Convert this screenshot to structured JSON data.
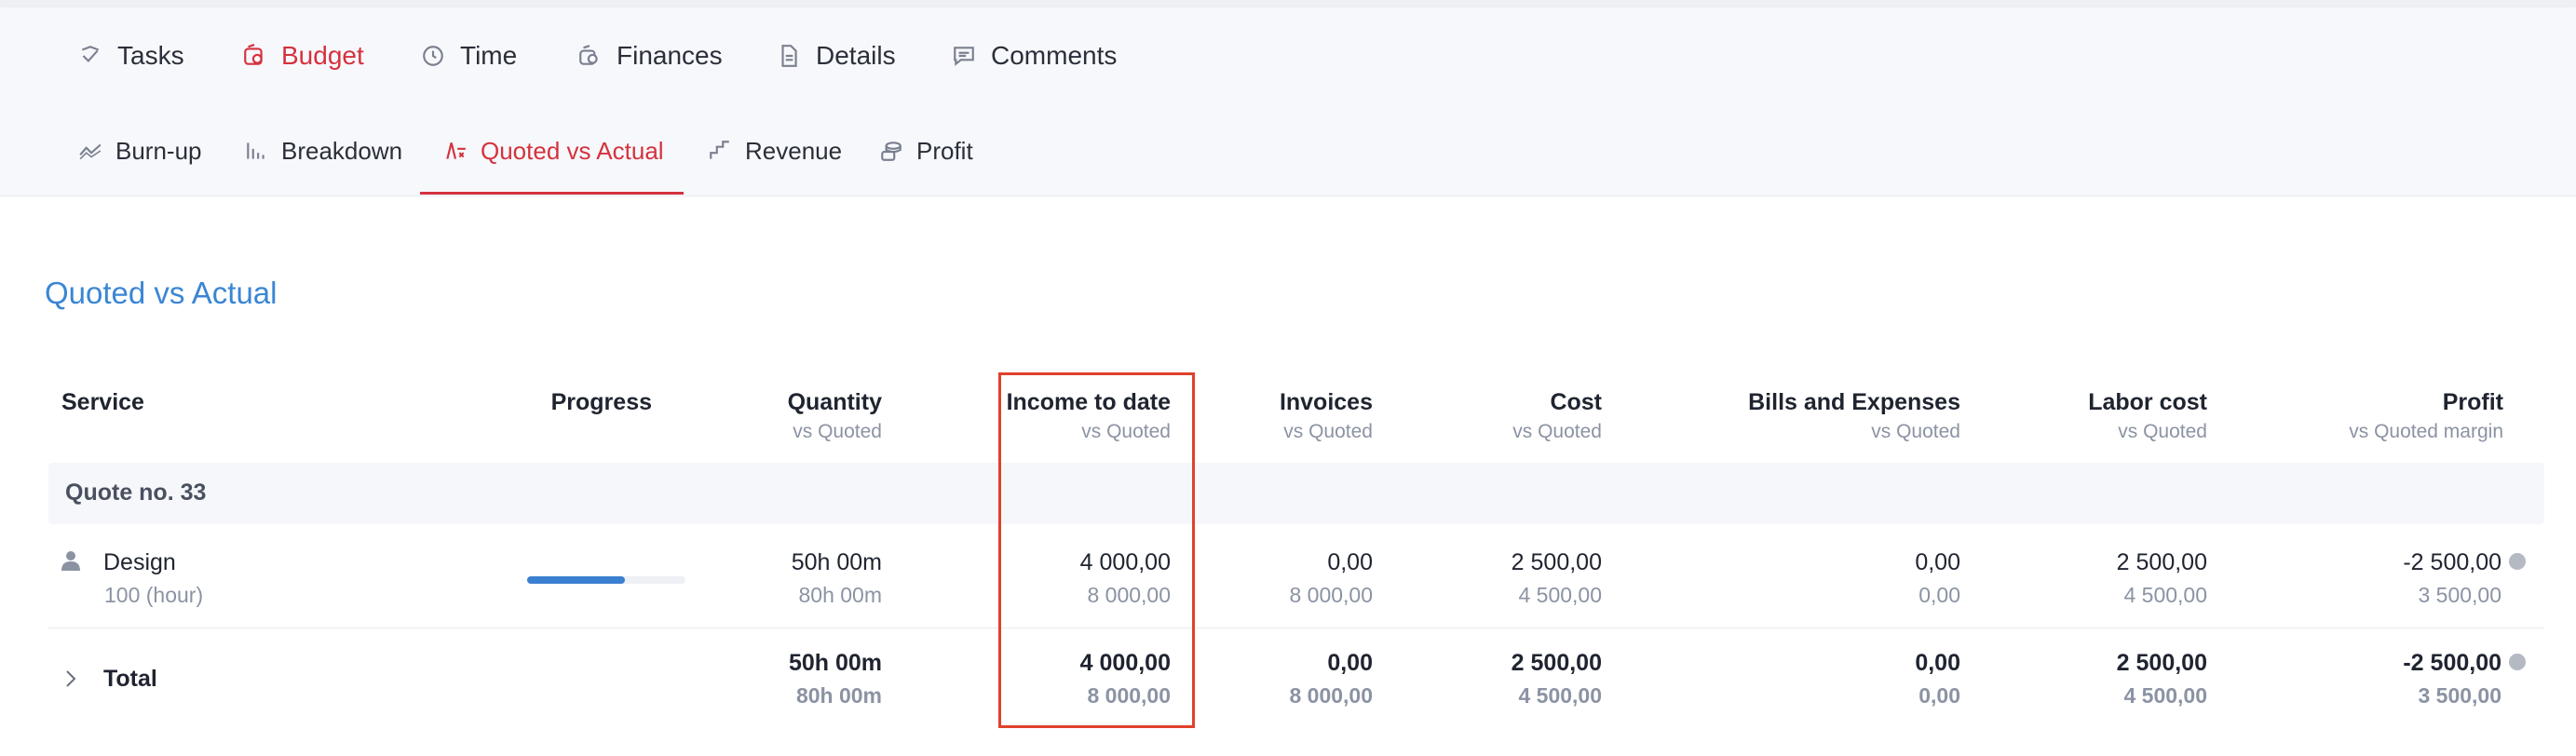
{
  "main_tabs": [
    {
      "label": "Tasks"
    },
    {
      "label": "Budget"
    },
    {
      "label": "Time"
    },
    {
      "label": "Finances"
    },
    {
      "label": "Details"
    },
    {
      "label": "Comments"
    }
  ],
  "sub_tabs": [
    {
      "label": "Burn-up"
    },
    {
      "label": "Breakdown"
    },
    {
      "label": "Quoted vs Actual"
    },
    {
      "label": "Revenue"
    },
    {
      "label": "Profit"
    }
  ],
  "section_title": "Quoted vs Actual",
  "columns": [
    {
      "title": "Service",
      "subtitle": ""
    },
    {
      "title": "Progress",
      "subtitle": ""
    },
    {
      "title": "Quantity",
      "subtitle": "vs Quoted"
    },
    {
      "title": "Income to date",
      "subtitle": "vs Quoted"
    },
    {
      "title": "Invoices",
      "subtitle": "vs Quoted"
    },
    {
      "title": "Cost",
      "subtitle": "vs Quoted"
    },
    {
      "title": "Bills and Expenses",
      "subtitle": "vs Quoted"
    },
    {
      "title": "Labor cost",
      "subtitle": "vs Quoted"
    },
    {
      "title": "Profit",
      "subtitle": "vs Quoted margin"
    }
  ],
  "group": {
    "label": "Quote no. 33"
  },
  "rows": [
    {
      "service": "Design",
      "unit": "100 (hour)",
      "progress": 0.62,
      "quantity": "50h 00m",
      "quantity_quoted": "80h 00m",
      "income": "4 000,00",
      "income_quoted": "8 000,00",
      "invoices": "0,00",
      "invoices_quoted": "8 000,00",
      "cost": "2 500,00",
      "cost_quoted": "4 500,00",
      "bills": "0,00",
      "bills_quoted": "0,00",
      "labor": "2 500,00",
      "labor_quoted": "4 500,00",
      "profit": "-2 500,00",
      "profit_quoted": "3 500,00"
    }
  ],
  "total": {
    "label": "Total",
    "quantity": "50h 00m",
    "quantity_quoted": "80h 00m",
    "income": "4 000,00",
    "income_quoted": "8 000,00",
    "invoices": "0,00",
    "invoices_quoted": "8 000,00",
    "cost": "2 500,00",
    "cost_quoted": "4 500,00",
    "bills": "0,00",
    "bills_quoted": "0,00",
    "labor": "2 500,00",
    "labor_quoted": "4 500,00",
    "profit": "-2 500,00",
    "profit_quoted": "3 500,00"
  },
  "colors": {
    "accent": "#d4323e",
    "link": "#3a86d4",
    "highlight": "#e0412c",
    "progress": "#3a7fd0"
  }
}
